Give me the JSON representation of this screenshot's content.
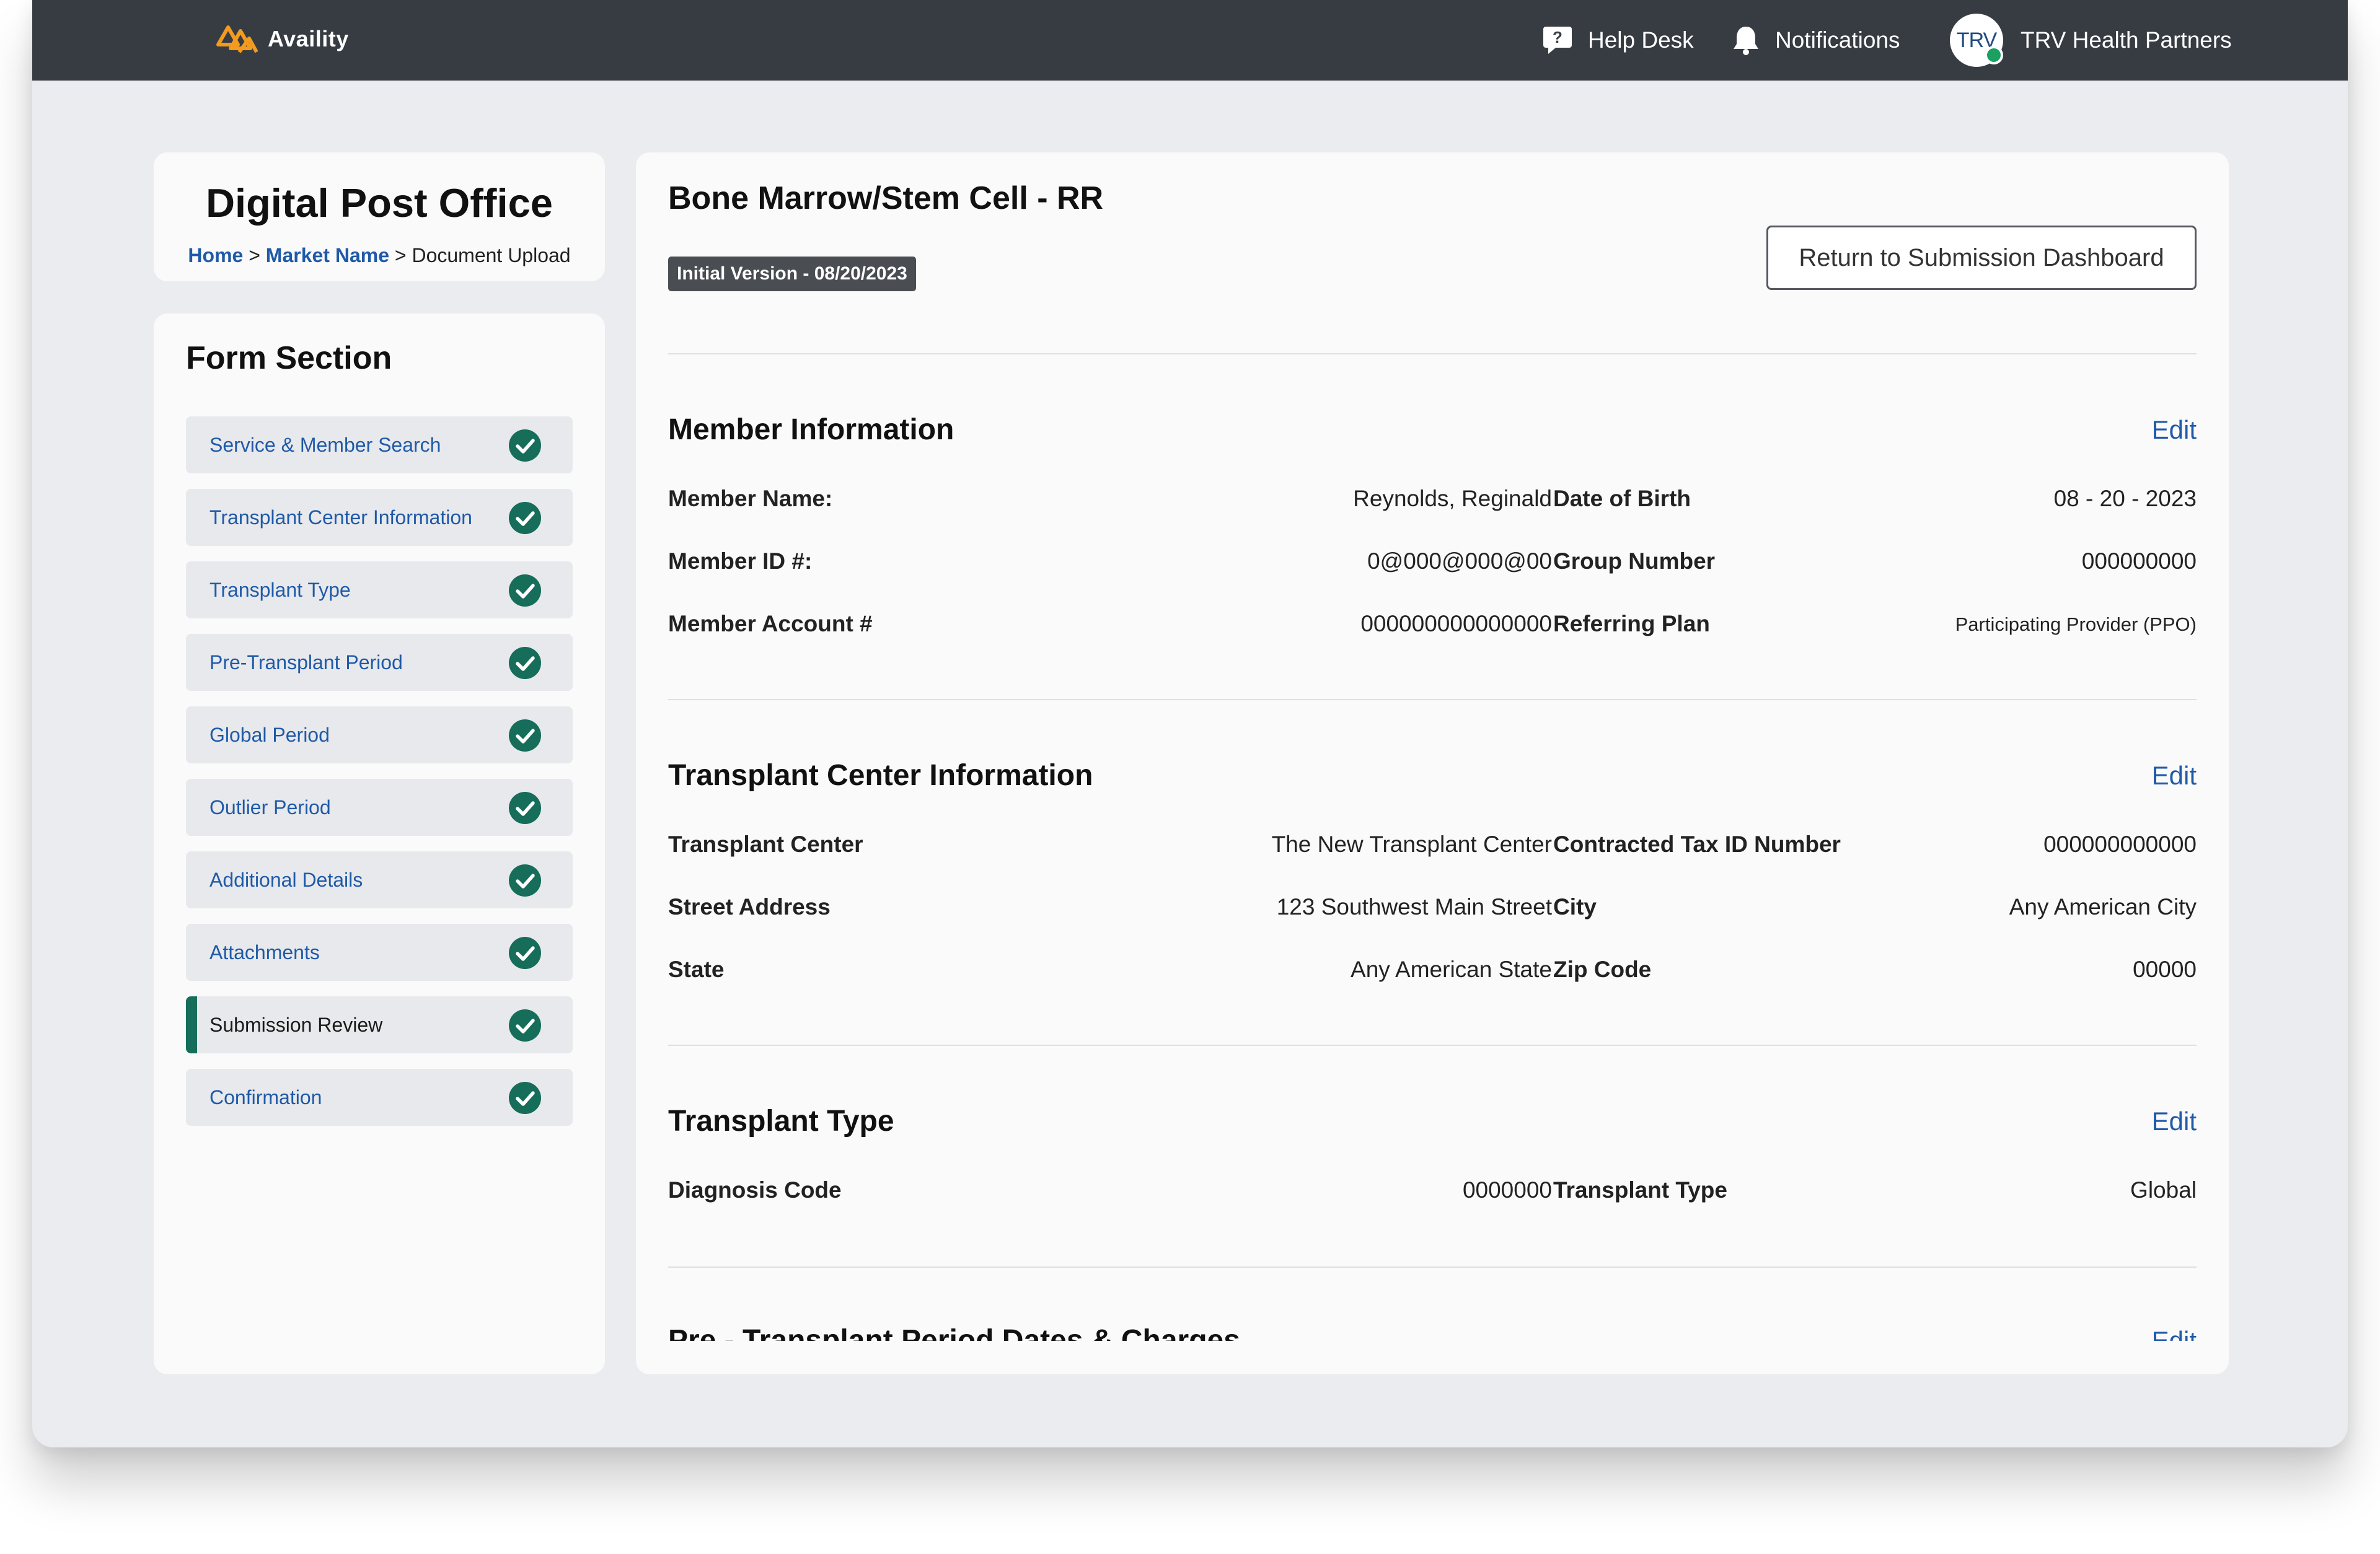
{
  "header": {
    "logo_text": "Availity",
    "help_desk": "Help Desk",
    "notifications": "Notifications",
    "avatar_initials": "TRV",
    "org_name": "TRV Health Partners"
  },
  "title_card": {
    "title": "Digital Post Office",
    "breadcrumb_home": "Home",
    "breadcrumb_sep1": ">",
    "breadcrumb_market": "Market Name",
    "breadcrumb_sep2": ">",
    "breadcrumb_current": "Document Upload"
  },
  "form_section": {
    "title": "Form Section",
    "items": [
      {
        "label": "Service & Member Search"
      },
      {
        "label": "Transplant Center Information"
      },
      {
        "label": "Transplant Type"
      },
      {
        "label": "Pre-Transplant Period"
      },
      {
        "label": "Global Period"
      },
      {
        "label": "Outlier Period"
      },
      {
        "label": "Additional Details"
      },
      {
        "label": "Attachments"
      },
      {
        "label": "Submission Review",
        "active": true
      },
      {
        "label": "Confirmation"
      }
    ]
  },
  "main": {
    "title": "Bone Marrow/Stem Cell - RR",
    "version": "Initial Version - 08/20/2023",
    "return_button": "Return to Submission Dashboard",
    "edit_label": "Edit",
    "sections": {
      "member": {
        "title": "Member Information",
        "fields": [
          {
            "label": "Member Name:",
            "value": "Reynolds, Reginald"
          },
          {
            "label": "Date of Birth",
            "value": "08 - 20 - 2023"
          },
          {
            "label": "Member ID #:",
            "value": "0@000@000@00"
          },
          {
            "label": "Group Number",
            "value": "000000000"
          },
          {
            "label": "Member Account #",
            "value": "000000000000000"
          },
          {
            "label": "Referring Plan",
            "value": "Participating Provider (PPO)"
          }
        ]
      },
      "center": {
        "title": "Transplant Center Information",
        "fields": [
          {
            "label": "Transplant Center",
            "value": "The New Transplant Center"
          },
          {
            "label": "Contracted Tax ID Number",
            "value": "000000000000"
          },
          {
            "label": "Street Address",
            "value": "123 Southwest Main Street"
          },
          {
            "label": "City",
            "value": "Any American City"
          },
          {
            "label": "State",
            "value": "Any American State"
          },
          {
            "label": "Zip Code",
            "value": "00000"
          }
        ]
      },
      "type": {
        "title": "Transplant Type",
        "fields": [
          {
            "label": "Diagnosis Code",
            "value": "0000000"
          },
          {
            "label": "Transplant Type",
            "value": "Global"
          }
        ]
      },
      "pre": {
        "title": "Pre - Transplant Period Dates & Charges"
      }
    }
  },
  "colors": {
    "topbar": "#373c43",
    "link": "#1f5aa8",
    "check": "#156d5a",
    "badge": "#4a4d52"
  }
}
